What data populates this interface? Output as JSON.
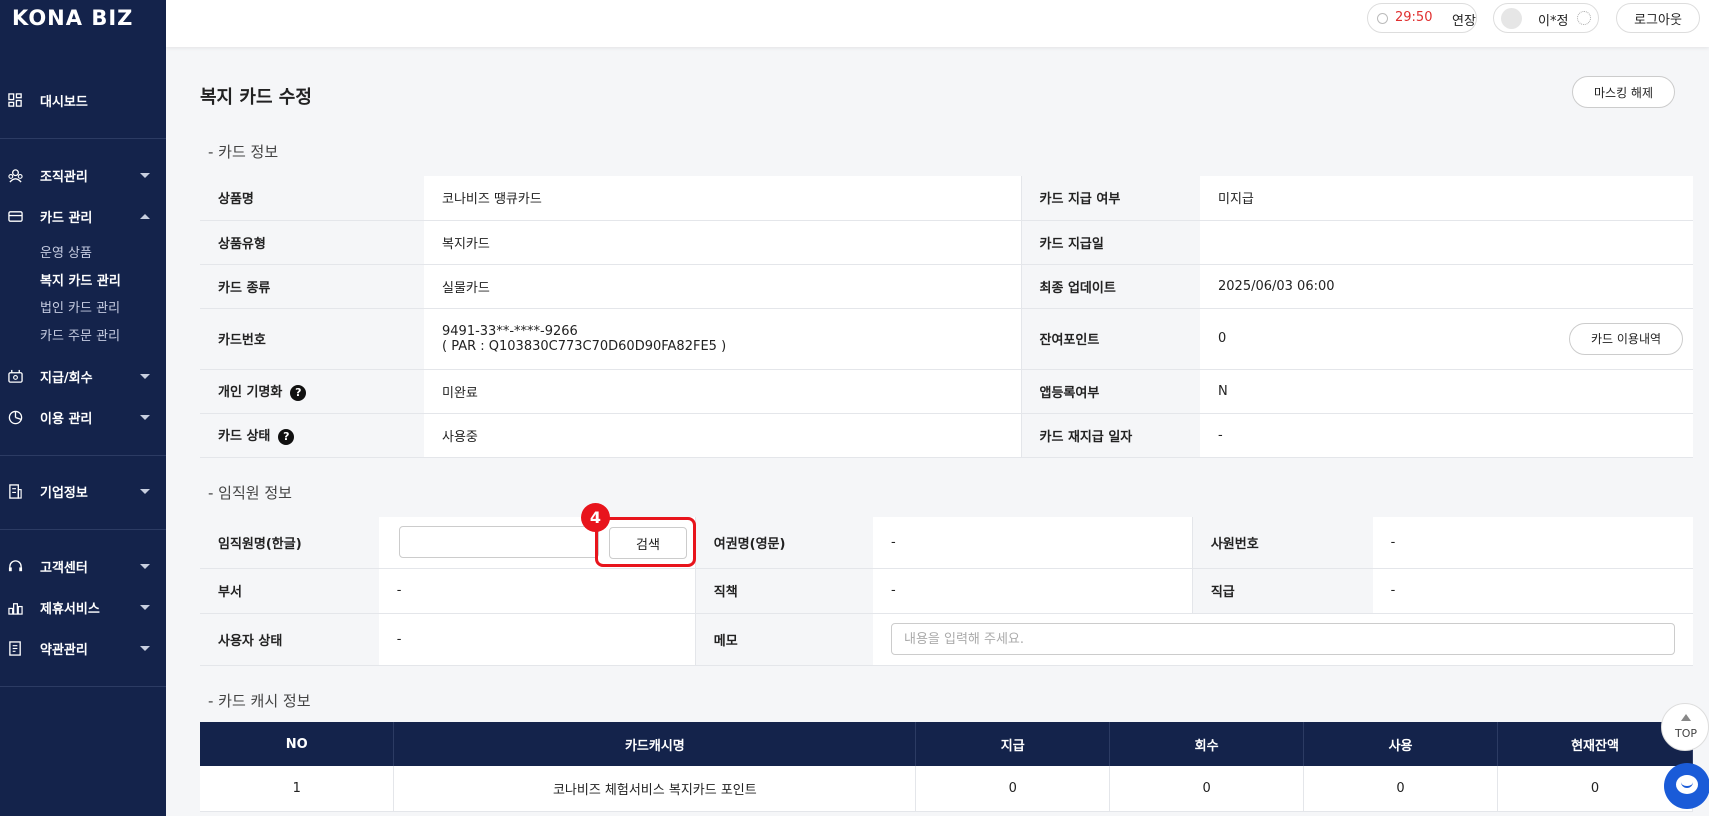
{
  "logo": "KONA BIZ",
  "topbar": {
    "timer": "29:50",
    "extend_label": "연장",
    "user_name": "이*정",
    "logout_label": "로그아웃"
  },
  "sidebar": {
    "dashboard": "대시보드",
    "org": "조직관리",
    "card": "카드 관리",
    "card_sub": [
      "운영 상품",
      "복지 카드 관리",
      "법인 카드 관리",
      "카드 주문 관리"
    ],
    "payment": "지급/회수",
    "usage": "이용 관리",
    "company": "기업정보",
    "support": "고객센터",
    "partner": "제휴서비스",
    "terms": "약관관리"
  },
  "page": {
    "title": "복지 카드 수정",
    "unmask_label": "마스킹 해제"
  },
  "card_info": {
    "section": "- 카드 정보",
    "rows": [
      {
        "l1": "상품명",
        "v1": "코나비즈 땡큐카드",
        "l2": "카드 지급 여부",
        "v2": "미지급"
      },
      {
        "l1": "상품유형",
        "v1": "복지카드",
        "l2": "카드 지급일",
        "v2": ""
      },
      {
        "l1": "카드 종류",
        "v1": "실물카드",
        "l2": "최종 업데이트",
        "v2": "2025/06/03 06:00"
      },
      {
        "l1": "카드번호",
        "v1": "9491-33**-****-9266",
        "v1b": "( PAR : Q103830C773C70D60D90FA82FE5 )",
        "l2": "잔여포인트",
        "v2": "0"
      },
      {
        "l1": "개인 기명화",
        "v1": "미완료",
        "l2": "앱등록여부",
        "v2": "N"
      },
      {
        "l1": "카드 상태",
        "v1": "사용중",
        "l2": "카드 재지급 일자",
        "v2": "-"
      }
    ],
    "usage_history_label": "카드 이용내역"
  },
  "employee_info": {
    "section": "- 임직원 정보",
    "name_label": "임직원명(한글)",
    "name_value": "",
    "search_label": "검색",
    "badge": "4",
    "passport_label": "여권명(영문)",
    "passport_value": "-",
    "empno_label": "사원번호",
    "empno_value": "-",
    "dept_label": "부서",
    "dept_value": "-",
    "duty_label": "직책",
    "duty_value": "-",
    "rank_label": "직급",
    "rank_value": "-",
    "status_label": "사용자 상태",
    "status_value": "-",
    "memo_label": "메모",
    "memo_placeholder": "내용을 입력해 주세요."
  },
  "cash_info": {
    "section": "- 카드 캐시 정보",
    "headers": [
      "NO",
      "카드캐시명",
      "지급",
      "회수",
      "사용",
      "현재잔액"
    ],
    "rows": [
      [
        "1",
        "코나비즈 체험서비스 복지카드 포인트",
        "0",
        "0",
        "0",
        "0"
      ]
    ]
  },
  "float": {
    "top_label": "TOP"
  }
}
